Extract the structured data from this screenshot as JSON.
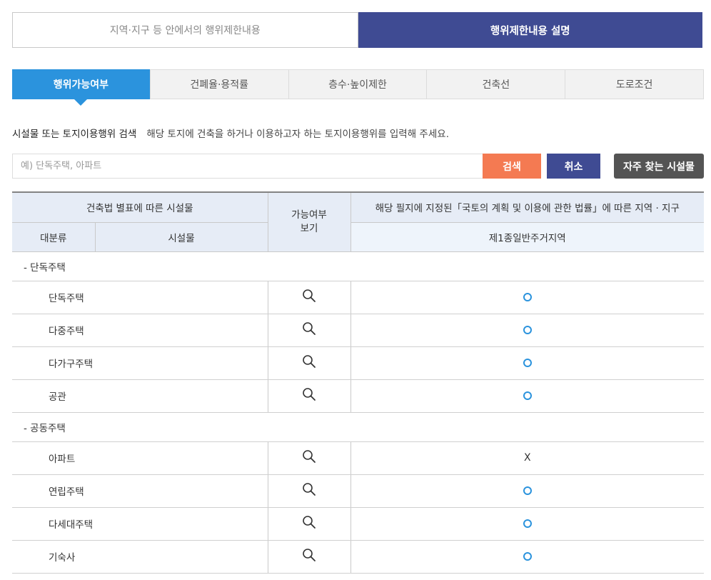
{
  "top_tabs": [
    {
      "label": "지역·지구 등 안에서의 행위제한내용",
      "active": false
    },
    {
      "label": "행위제한내용 설명",
      "active": true
    }
  ],
  "sub_tabs": [
    {
      "label": "행위가능여부",
      "active": true
    },
    {
      "label": "건폐율·용적률",
      "active": false
    },
    {
      "label": "층수·높이제한",
      "active": false
    },
    {
      "label": "건축선",
      "active": false
    },
    {
      "label": "도로조건",
      "active": false
    }
  ],
  "search": {
    "title": "시설물 또는 토지이용행위 검색",
    "description": "해당 토지에 건축을 하거나 이용하고자 하는 토지이용행위를 입력해 주세요.",
    "placeholder": "예) 단독주택, 아파트",
    "value": "",
    "search_label": "검색",
    "cancel_label": "취소",
    "frequent_label": "자주 찾는 시설물"
  },
  "table": {
    "header_facility": "건축법 별표에 따른 시설물",
    "header_available_line1": "가능여부",
    "header_available_line2": "보기",
    "header_law": "해당 필지에 지정된「국토의 계획 및 이용에 관한 법률」에 따른 지역 · 지구",
    "header_category": "대분류",
    "header_facility_name": "시설물",
    "header_zone": "제1종일반주거지역",
    "rows": [
      {
        "type": "category",
        "label": "- 단독주택"
      },
      {
        "type": "item",
        "name": "단독주택",
        "result": "O"
      },
      {
        "type": "item",
        "name": "다중주택",
        "result": "O"
      },
      {
        "type": "item",
        "name": "다가구주택",
        "result": "O"
      },
      {
        "type": "item",
        "name": "공관",
        "result": "O"
      },
      {
        "type": "category",
        "label": "- 공동주택"
      },
      {
        "type": "item",
        "name": "아파트",
        "result": "X"
      },
      {
        "type": "item",
        "name": "연립주택",
        "result": "O"
      },
      {
        "type": "item",
        "name": "다세대주택",
        "result": "O"
      },
      {
        "type": "item",
        "name": "기숙사",
        "result": "O"
      }
    ]
  },
  "icons": {
    "search_row": "magnifier-icon",
    "result_allowed": "circle-icon"
  },
  "colors": {
    "primary_navy": "#3f4b93",
    "tab_blue": "#2b93dd",
    "search_orange": "#f47a52",
    "frequent_gray": "#545454",
    "header_bg": "#e6ecf6"
  }
}
